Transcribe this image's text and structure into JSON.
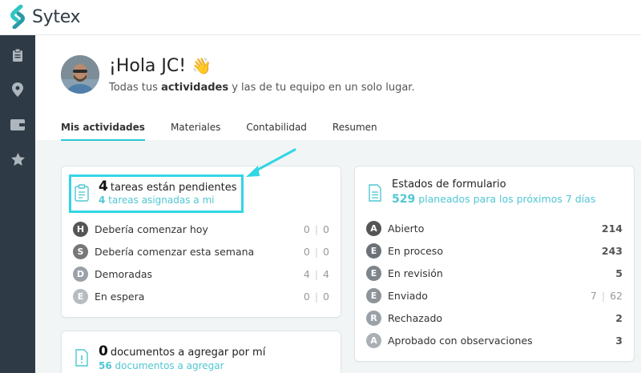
{
  "app": {
    "name": "Sytex"
  },
  "sidebar": {
    "items": [
      {
        "icon": "clipboard-icon"
      },
      {
        "icon": "map-pin-icon"
      },
      {
        "icon": "wallet-icon"
      },
      {
        "icon": "star-icon"
      }
    ]
  },
  "header": {
    "greeting": "¡Hola JC!",
    "emoji": "👋",
    "subtitle_pre": "Todas tus ",
    "subtitle_bold": "actividades",
    "subtitle_post": " y las de tu equipo en un solo lugar."
  },
  "tabs": [
    {
      "label": "Mis actividades",
      "active": true
    },
    {
      "label": "Materiales",
      "active": false
    },
    {
      "label": "Contabilidad",
      "active": false
    },
    {
      "label": "Resumen",
      "active": false
    }
  ],
  "tasks_card": {
    "count": "4",
    "title": "tareas están pendientes",
    "sub_count": "4",
    "sub_text": "tareas asignadas a mi",
    "rows": [
      {
        "letter": "H",
        "label": "Debería comenzar hoy",
        "a": "0",
        "b": "0"
      },
      {
        "letter": "S",
        "label": "Debería comenzar esta semana",
        "a": "0",
        "b": "0"
      },
      {
        "letter": "D",
        "label": "Demoradas",
        "a": "4",
        "b": "4"
      },
      {
        "letter": "E",
        "label": "En espera",
        "a": "0",
        "b": "0"
      }
    ]
  },
  "docs_card": {
    "count": "0",
    "title": "documentos a agregar por mí",
    "sub_count": "56",
    "sub_text": "documentos a agregar"
  },
  "forms_card": {
    "title": "Estados de formulario",
    "sub_count": "529",
    "sub_text": "planeados para los próximos 7 días",
    "rows": [
      {
        "letter": "A",
        "label": "Abierto",
        "value": "214"
      },
      {
        "letter": "E",
        "label": "En proceso",
        "value": "243"
      },
      {
        "letter": "E",
        "label": "En revisión",
        "value": "5"
      },
      {
        "letter": "E",
        "label": "Enviado",
        "a": "7",
        "b": "62"
      },
      {
        "letter": "R",
        "label": "Rechazado",
        "value": "2"
      },
      {
        "letter": "A",
        "label": "Aprobado con observaciones",
        "value": "3"
      }
    ]
  },
  "colors": {
    "accent": "#29c8d6",
    "highlight": "#33d6e5",
    "sidebar": "#2e3a45",
    "badge_dark": "#555555",
    "badge_light": "#9aa1a8"
  }
}
